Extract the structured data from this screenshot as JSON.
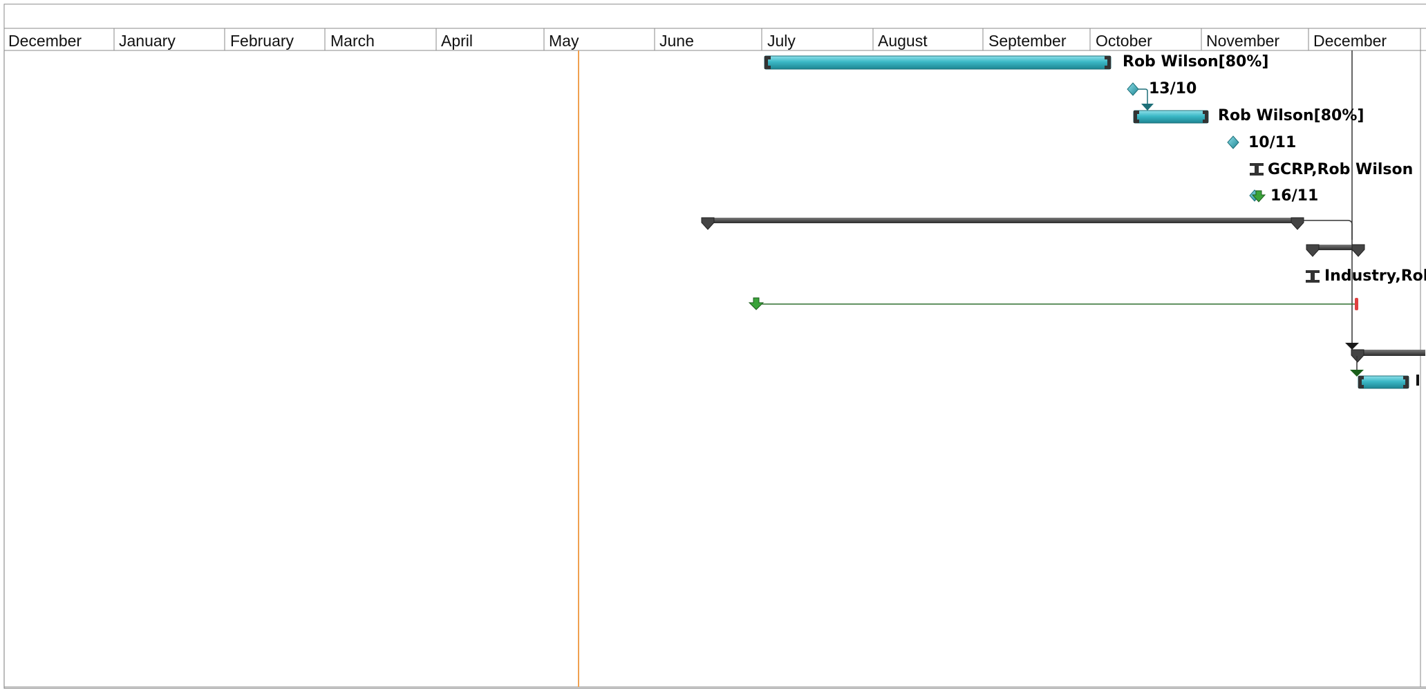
{
  "timescale": {
    "months": [
      "December",
      "January",
      "February",
      "March",
      "April",
      "May",
      "June",
      "July",
      "August",
      "September",
      "October",
      "November",
      "December"
    ]
  },
  "labels": {
    "row1": "Rob Wilson[80%]",
    "row2": "13/10",
    "row3": "Rob Wilson[80%]",
    "row4": "10/11",
    "row5": "GCRP,Rob Wilson",
    "row6": "16/11",
    "row9": "Industry,Rob"
  },
  "colors": {
    "task_bar": "#3bb8c6",
    "summary_bar": "#404040",
    "milestone": "#3aa9b5",
    "today_line": "#f0a050",
    "deadline_marker": "#3a9a3a",
    "deadline_line": "#2f6f2f",
    "status_marker": "#e04040"
  }
}
